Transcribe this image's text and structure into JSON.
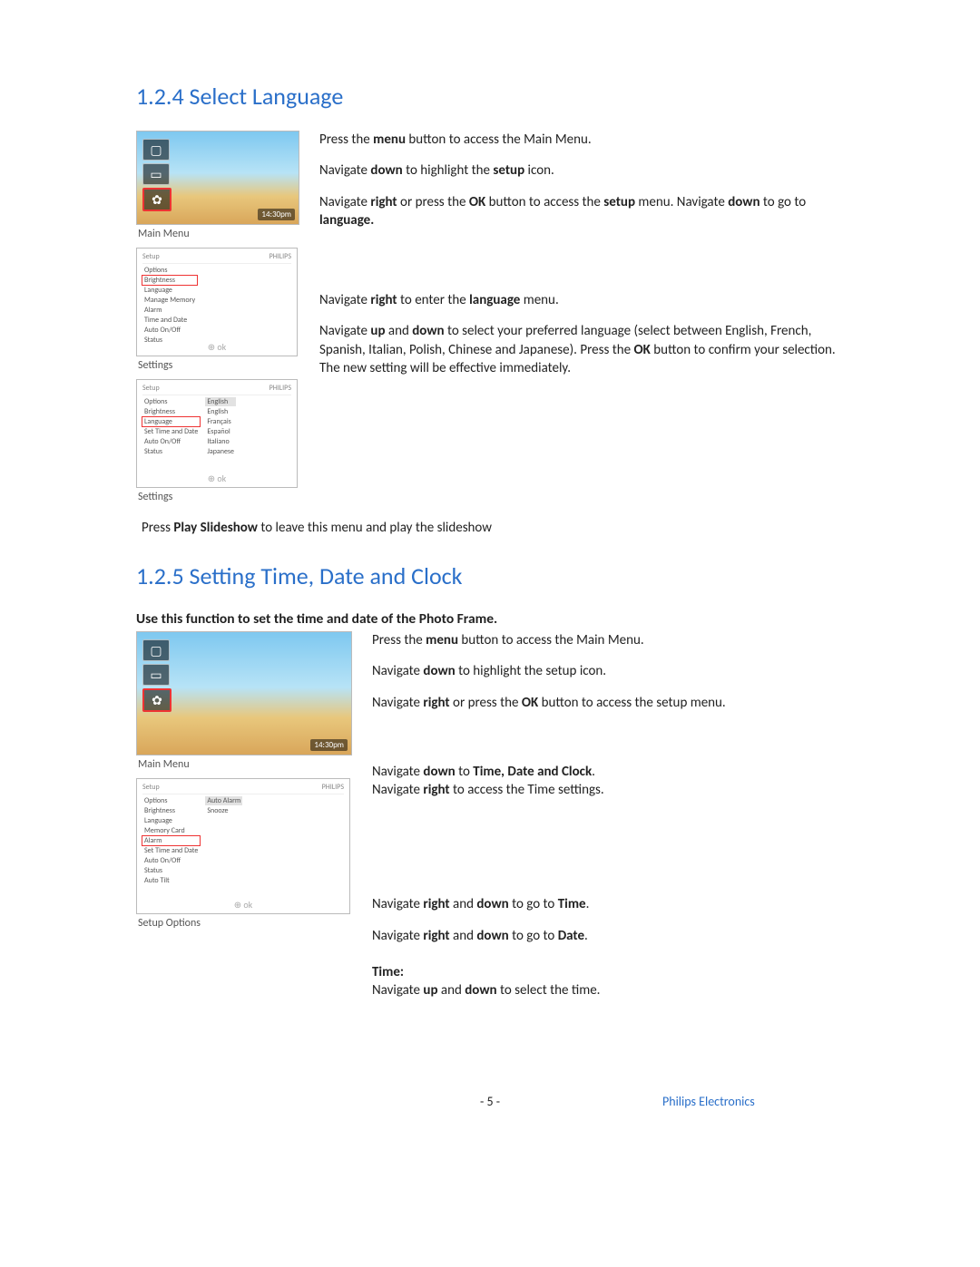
{
  "sections": {
    "s124": {
      "heading": "1.2.4 Select Language",
      "caption1": "Main Menu",
      "caption2": "Settings",
      "caption3": "Settings",
      "p1_a": "Press the ",
      "p1_b": "menu",
      "p1_c": " button to access the Main Menu.",
      "p2_a": "Navigate ",
      "p2_b": "down",
      "p2_c": " to highlight the ",
      "p2_d": "setup",
      "p2_e": " icon.",
      "p3_a": "Navigate ",
      "p3_b": "right",
      "p3_c": " or press the ",
      "p3_d": "OK",
      "p3_e": " button to access the ",
      "p3_f": "setup",
      "p3_g": " menu. Navigate ",
      "p3_h": "down",
      "p3_i": " to  go  to ",
      "p3_j": "language.",
      "p4_a": "Navigate ",
      "p4_b": "right",
      "p4_c": " to enter the ",
      "p4_d": "language",
      "p4_e": " menu.",
      "p5_a": "Navigate ",
      "p5_b": "up",
      "p5_c": " and ",
      "p5_d": "down",
      "p5_e": " to select your preferred language (select between English, French, Spanish, Italian, Polish, Chinese and Japanese). Press the ",
      "p5_f": "OK",
      "p5_g": " button to confirm your selection. The new setting will be effective immediately.",
      "slide_a": "Press ",
      "slide_b": "Play Slideshow",
      "slide_c": " to leave this menu and play the slideshow"
    },
    "s125": {
      "heading": "1.2.5 Setting Time, Date and Clock",
      "intro": "Use this function to set the time and date of the Photo Frame.",
      "caption1": "Main Menu",
      "caption2": "Setup Options",
      "p1_a": "Press the ",
      "p1_b": "menu",
      "p1_c": " button to access the Main Menu.",
      "p2_a": "Navigate ",
      "p2_b": "down",
      "p2_c": " to highlight the setup icon.",
      "p3_a": "Navigate ",
      "p3_b": "right",
      "p3_c": " or press the ",
      "p3_d": "OK",
      "p3_e": " button to access the setup menu.",
      "p4_a": "Navigate ",
      "p4_b": "down",
      "p4_c": " to ",
      "p4_d": "Time, Date and Clock",
      "p4_e": ".",
      "p5_a": "Navigate ",
      "p5_b": "right",
      "p5_c": " to access the Time settings.",
      "p6_a": "Navigate ",
      "p6_b": "right",
      "p6_c": " and ",
      "p6_d": "down",
      "p6_e": " to go to ",
      "p6_f": "Time",
      "p6_g": ".",
      "p7_a": "Navigate ",
      "p7_b": "right",
      "p7_c": " and ",
      "p7_d": "down",
      "p7_e": " to go to ",
      "p7_f": "Date",
      "p7_g": ".",
      "time_label": "Time:",
      "p8_a": "Navigate ",
      "p8_b": "up",
      "p8_c": " and ",
      "p8_d": "down",
      "p8_e": " to select the time."
    }
  },
  "thumbs": {
    "clock": "14:30pm",
    "brand": "PHILIPS",
    "settings_hdr": "Setup",
    "options_hdr": "Options",
    "settings1": [
      "Setup",
      "Options",
      "Brightness",
      "Language",
      "Manage Memory",
      "Alarm",
      "Time and Date",
      "Auto On/Off",
      "Status"
    ],
    "settings2_left": [
      "Setup",
      "Options",
      "Brightness",
      "Language",
      "Set Time and Date",
      "Auto On/Off",
      "Status"
    ],
    "settings2_right": [
      "English",
      "English",
      "Français",
      "Español",
      "Italiano",
      "Japanese"
    ],
    "settings3_left": [
      "Options",
      "Brightness",
      "Language",
      "Memory Card",
      "Alarm",
      "Set Time and Date",
      "Auto On/Off",
      "Status",
      "Auto Tilt"
    ],
    "settings3_right": [
      "Auto Alarm",
      "Snooze"
    ]
  },
  "footer": {
    "page": "- 5 -",
    "brand": "Philips Electronics"
  }
}
